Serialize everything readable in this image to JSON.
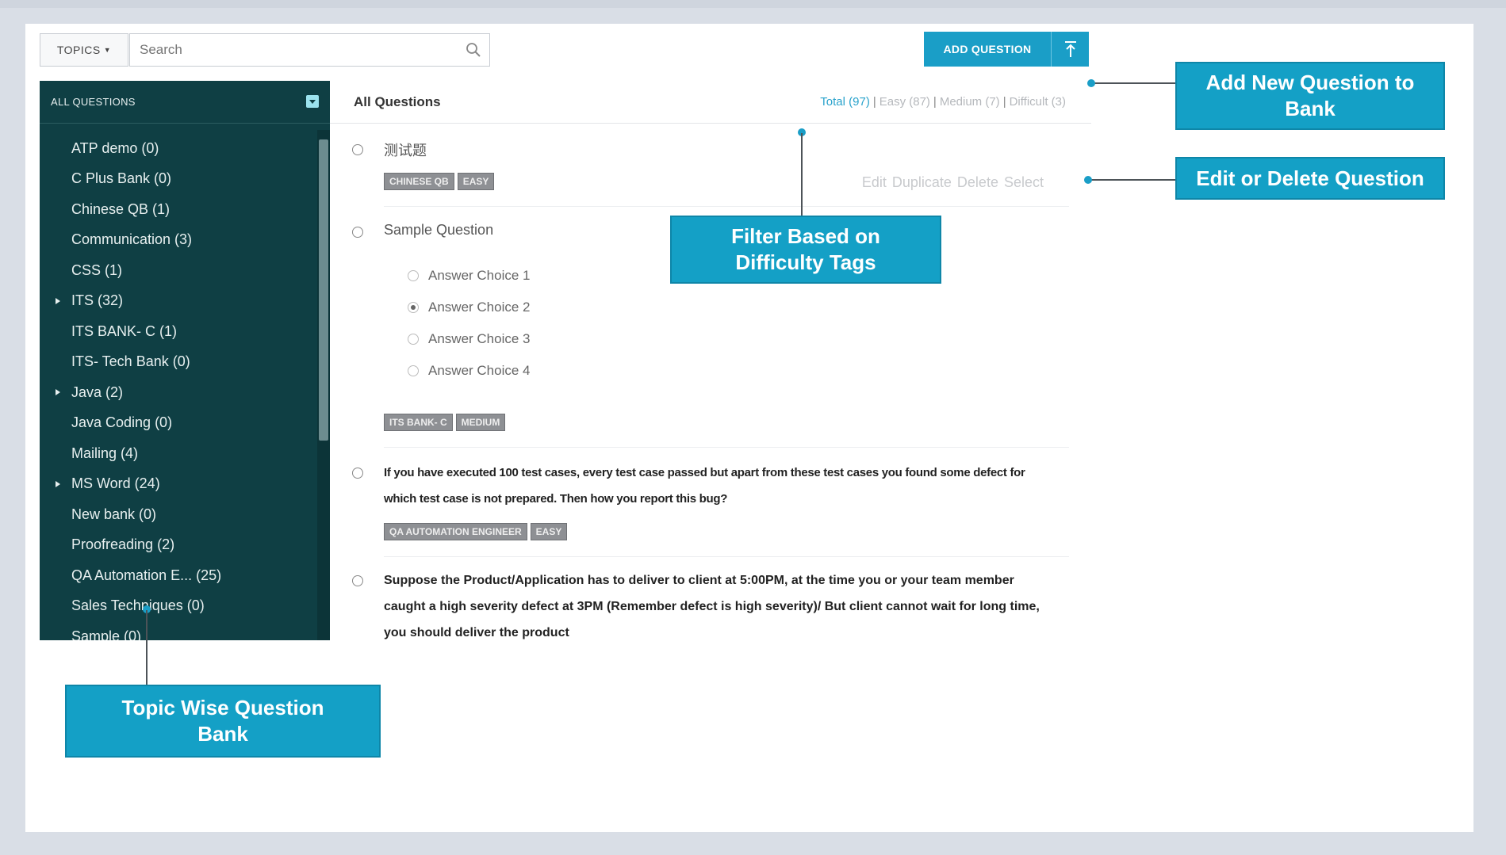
{
  "toolbar": {
    "topics_label": "TOPICS",
    "search_placeholder": "Search",
    "add_question_label": "ADD QUESTION"
  },
  "sidebar": {
    "header": "ALL QUESTIONS",
    "items": [
      {
        "label": "ATP demo (0)",
        "expandable": false
      },
      {
        "label": "C Plus Bank (0)",
        "expandable": false
      },
      {
        "label": "Chinese QB (1)",
        "expandable": false
      },
      {
        "label": "Communication (3)",
        "expandable": false
      },
      {
        "label": "CSS (1)",
        "expandable": false
      },
      {
        "label": "ITS (32)",
        "expandable": true
      },
      {
        "label": "ITS BANK- C (1)",
        "expandable": false
      },
      {
        "label": "ITS- Tech Bank (0)",
        "expandable": false
      },
      {
        "label": "Java (2)",
        "expandable": true
      },
      {
        "label": "Java Coding (0)",
        "expandable": false
      },
      {
        "label": "Mailing (4)",
        "expandable": false
      },
      {
        "label": "MS Word (24)",
        "expandable": true
      },
      {
        "label": "New bank (0)",
        "expandable": false
      },
      {
        "label": "Proofreading (2)",
        "expandable": false
      },
      {
        "label": "QA Automation E...   (25)",
        "expandable": false
      },
      {
        "label": "Sales Techniques (0)",
        "expandable": false
      },
      {
        "label": "Sample (0)",
        "expandable": false
      }
    ]
  },
  "main": {
    "title": "All Questions",
    "filters": {
      "total": "Total (97)",
      "easy": "Easy (87)",
      "medium": "Medium (7)",
      "difficult": "Difficult (3)"
    },
    "actions": {
      "edit": "Edit",
      "duplicate": "Duplicate",
      "delete": "Delete",
      "select": "Select"
    },
    "questions": [
      {
        "text": "测试题",
        "tags": [
          "CHINESE QB",
          "EASY"
        ]
      },
      {
        "text": "Sample Question",
        "choices": [
          "Answer Choice 1",
          "Answer Choice 2",
          "Answer Choice 3",
          "Answer Choice 4"
        ],
        "selected_choice": 2,
        "tags": [
          "ITS BANK- C",
          "MEDIUM"
        ]
      },
      {
        "text": "If you have executed 100 test cases, every test case passed but apart from these test cases you found some defect for which test case is not prepared. Then how you report this bug?",
        "tags": [
          "QA AUTOMATION ENGINEER",
          "EASY"
        ]
      },
      {
        "text": "Suppose the Product/Application has to deliver to client at 5:00PM, at the time you or your team member caught a high severity defect at 3PM (Remember defect is high severity)/ But client cannot wait for long time, you should deliver the product"
      }
    ]
  },
  "callouts": {
    "add_new": "Add New Question to Bank",
    "edit_delete": "Edit or Delete Question",
    "filter": "Filter Based on Difficulty Tags",
    "topic_bank": "Topic Wise Question Bank"
  },
  "colors": {
    "sidebar_bg": "#0f3f44",
    "accent": "#1a9ec7",
    "tag_bg": "#8e9094"
  }
}
